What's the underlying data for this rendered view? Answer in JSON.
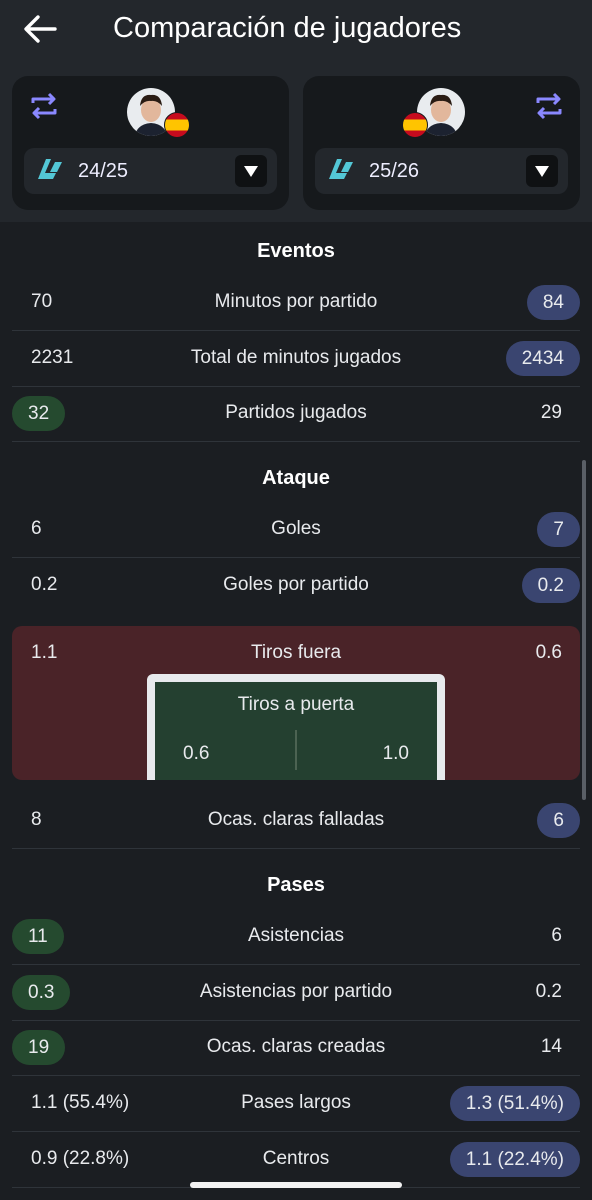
{
  "header": {
    "title": "Comparación de jugadores"
  },
  "players": {
    "left": {
      "season": "24/25"
    },
    "right": {
      "season": "25/26"
    }
  },
  "sections": {
    "eventos": "Eventos",
    "ataque": "Ataque",
    "pases": "Pases"
  },
  "eventos": [
    {
      "label": "Minutos por partido",
      "left": "70",
      "right": "84",
      "winner": "right"
    },
    {
      "label": "Total de minutos jugados",
      "left": "2231",
      "right": "2434",
      "winner": "right"
    },
    {
      "label": "Partidos jugados",
      "left": "32",
      "right": "29",
      "winner": "left"
    }
  ],
  "ataque": [
    {
      "label": "Goles",
      "left": "6",
      "right": "7",
      "winner": "right"
    },
    {
      "label": "Goles por partido",
      "left": "0.2",
      "right": "0.2",
      "winner": "right"
    }
  ],
  "tiros": {
    "label": "Tiros fuera",
    "left": "1.1",
    "right": "0.6",
    "on_target_label": "Tiros a puerta",
    "on_target_left": "0.6",
    "on_target_right": "1.0"
  },
  "ataque2": [
    {
      "label": "Ocas. claras falladas",
      "left": "8",
      "right": "6",
      "winner": "right"
    }
  ],
  "pases": [
    {
      "label": "Asistencias",
      "left": "11",
      "right": "6",
      "winner": "left"
    },
    {
      "label": "Asistencias por partido",
      "left": "0.3",
      "right": "0.2",
      "winner": "left"
    },
    {
      "label": "Ocas. claras creadas",
      "left": "19",
      "right": "14",
      "winner": "left"
    },
    {
      "label": "Pases largos",
      "left": "1.1 (55.4%)",
      "right": "1.3 (51.4%)",
      "winner": "right"
    },
    {
      "label": "Centros",
      "left": "0.9 (22.8%)",
      "right": "1.1 (22.4%)",
      "winner": "right"
    }
  ],
  "colors": {
    "winner_left": "#254a2f",
    "winner_right": "#3a4570",
    "highlight": "#4a2328",
    "accent": "#5aa0ff"
  }
}
